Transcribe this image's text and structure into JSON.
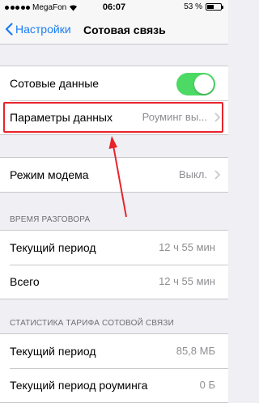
{
  "status_bar": {
    "carrier": "MegaFon",
    "time": "06:07",
    "battery": "53 %",
    "battery_level": 0.53
  },
  "nav": {
    "back_label": "Настройки",
    "title": "Сотовая связь"
  },
  "cellular": {
    "label": "Сотовые данные",
    "enabled": true
  },
  "data_options": {
    "label": "Параметры данных",
    "value": "Роуминг вы..."
  },
  "hotspot": {
    "label": "Режим модема",
    "value": "Выкл."
  },
  "call_time": {
    "header": "ВРЕМЯ РАЗГОВОРА",
    "rows": [
      {
        "label": "Текущий период",
        "value": "12 ч 55 мин"
      },
      {
        "label": "Всего",
        "value": "12 ч 55 мин"
      }
    ]
  },
  "stats": {
    "header": "СТАТИСТИКА ТАРИФА СОТОВОЙ СВЯЗИ",
    "rows": [
      {
        "label": "Текущий период",
        "value": "85,8 МБ"
      },
      {
        "label": "Текущий период роуминга",
        "value": "0 Б"
      }
    ]
  },
  "colors": {
    "accent": "#1a7cf5",
    "toggle_on": "#4cd964",
    "annotation": "#e8232b"
  }
}
